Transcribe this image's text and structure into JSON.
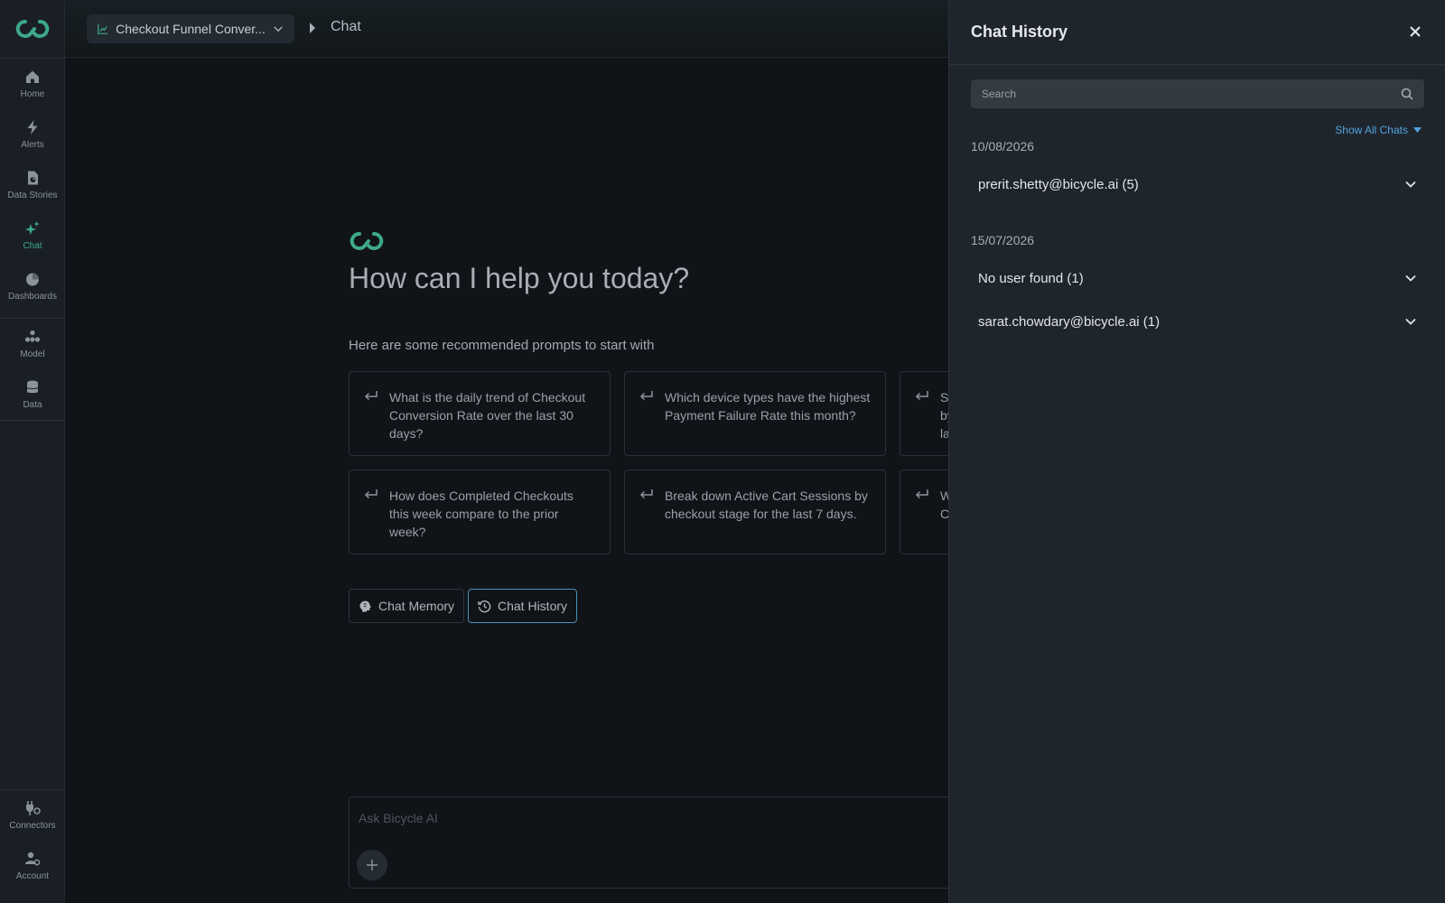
{
  "nav": {
    "items": [
      {
        "label": "Home",
        "icon": "home-icon"
      },
      {
        "label": "Alerts",
        "icon": "bolt-icon"
      },
      {
        "label": "Data Stories",
        "icon": "document-chart-icon"
      },
      {
        "label": "Chat",
        "icon": "sparkle-icon",
        "active": true
      },
      {
        "label": "Dashboards",
        "icon": "pie-chart-icon"
      },
      {
        "label": "Model",
        "icon": "model-icon"
      },
      {
        "label": "Data",
        "icon": "database-icon"
      },
      {
        "label": "Connectors",
        "icon": "plug-icon"
      },
      {
        "label": "Account",
        "icon": "user-settings-icon"
      }
    ]
  },
  "topbar": {
    "selector_label": "Checkout Funnel Conver...",
    "current": "Chat"
  },
  "main": {
    "heading": "How can I help you today?",
    "subheading": "Here are some recommended prompts to start with",
    "prompts": [
      "What is the daily trend of Checkout Conversion Rate over the last 30 days?",
      "Which device types have the highest Payment Failure Rate this month?",
      "Sh by la",
      "How does Completed Checkouts this week compare to the prior week?",
      "Break down Active Cart Sessions by checkout stage for the last 7 days.",
      "W C"
    ],
    "chips": {
      "memory": "Chat Memory",
      "history": "Chat History"
    },
    "ask_placeholder": "Ask Bicycle AI"
  },
  "panel": {
    "title": "Chat History",
    "search_placeholder": "Search",
    "show_all": "Show All Chats",
    "groups": [
      {
        "date": "10/08/2026",
        "items": [
          "prerit.shetty@bicycle.ai (5)"
        ]
      },
      {
        "date": "15/07/2026",
        "items": [
          "No user found (1)",
          "sarat.chowdary@bicycle.ai (1)"
        ]
      }
    ]
  },
  "colors": {
    "accent": "#3ea889",
    "link": "#4fa3e0",
    "panel_bg": "#1f252c",
    "app_bg": "#101419"
  }
}
